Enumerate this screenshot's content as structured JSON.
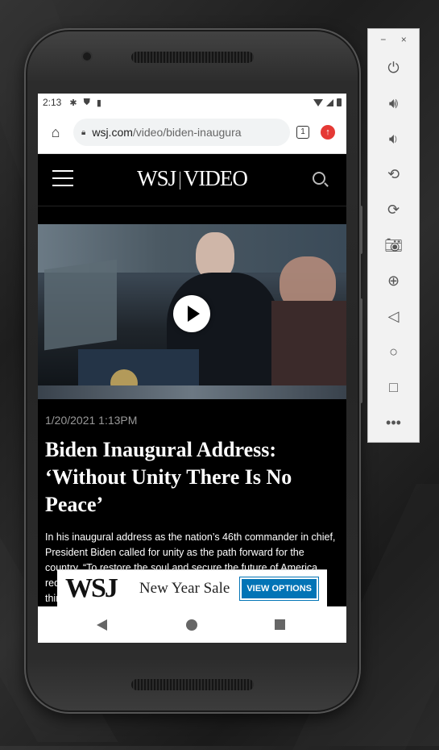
{
  "status_bar": {
    "time": "2:13"
  },
  "browser": {
    "url_host": "wsj.com",
    "url_path": "/video/biden-inaugura",
    "tab_count": "1"
  },
  "site": {
    "logo_left": "WSJ",
    "logo_sep": "|",
    "logo_right": "VIDEO"
  },
  "article": {
    "timestamp": "1/20/2021 1:13PM",
    "headline": "Biden Inaugural Address: ‘Without Unity There Is No Peace’",
    "summary": "In his inaugural address as the nation’s 46th commander in chief, President Biden called for unity as the path forward for the country. “To restore the soul and secure the future of America, requires more than words. It requires that most elusive of all things in a democracy: unity.” Biden said."
  },
  "ad": {
    "brand": "WSJ",
    "headline": "New Year Sale",
    "cta": "VIEW OPTIONS"
  },
  "emulator_toolbar": {
    "minimize": "−",
    "close": "×",
    "items": [
      "power-icon",
      "volume-up-icon",
      "volume-down-icon",
      "rotate-left-icon",
      "rotate-right-icon",
      "camera-icon",
      "zoom-icon",
      "back-icon",
      "home-icon",
      "overview-icon",
      "more-icon"
    ]
  },
  "colors": {
    "ad_button": "#0274b6",
    "update_badge": "#e53935"
  }
}
